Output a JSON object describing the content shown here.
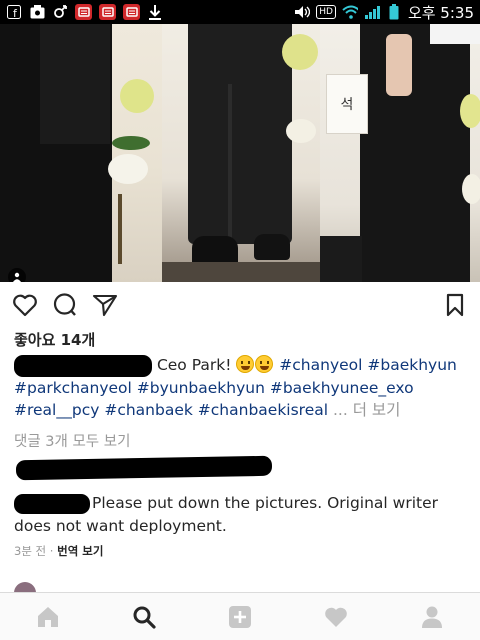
{
  "status_bar": {
    "time": "오후 5:35",
    "hd_label": "HD",
    "icons": [
      "facebook-icon",
      "media-icon",
      "gender-icon",
      "notification-icon",
      "notification-icon",
      "notification-icon",
      "download-icon",
      "volume-icon",
      "hd-icon",
      "wifi-icon",
      "signal-icon",
      "battery-icon"
    ]
  },
  "post": {
    "photo": {
      "sign_text": "석"
    },
    "likes": "좋아요 14개",
    "caption": {
      "text": "Ceo Park!",
      "hashtags_line1": [
        "#chanyeol",
        "#baekhyun"
      ],
      "hashtags_line2": [
        "#parkchanyeol",
        "#byunbaekhyun",
        "#baekhyunee_exo"
      ],
      "hashtags_line3": [
        "#real__pcy",
        "#chanbaek",
        "#chanbaekisreal"
      ],
      "more_label": "... 더 보기"
    },
    "view_all_comments": "댓글 3개 모두 보기",
    "comment_2": {
      "text_line1": "Please put down the pictures. Original writer",
      "text_line2": "does not want deployment."
    },
    "meta": {
      "time_ago": "3분 전",
      "separator": " · ",
      "translate_label": "번역 보기"
    }
  },
  "bottom_nav": {
    "items": [
      "home-icon",
      "search-icon",
      "add-post-icon",
      "activity-icon",
      "profile-icon"
    ]
  },
  "colors": {
    "hashtag": "#10387a",
    "muted": "#999999",
    "text": "#262626",
    "status_bar": "#000000"
  }
}
